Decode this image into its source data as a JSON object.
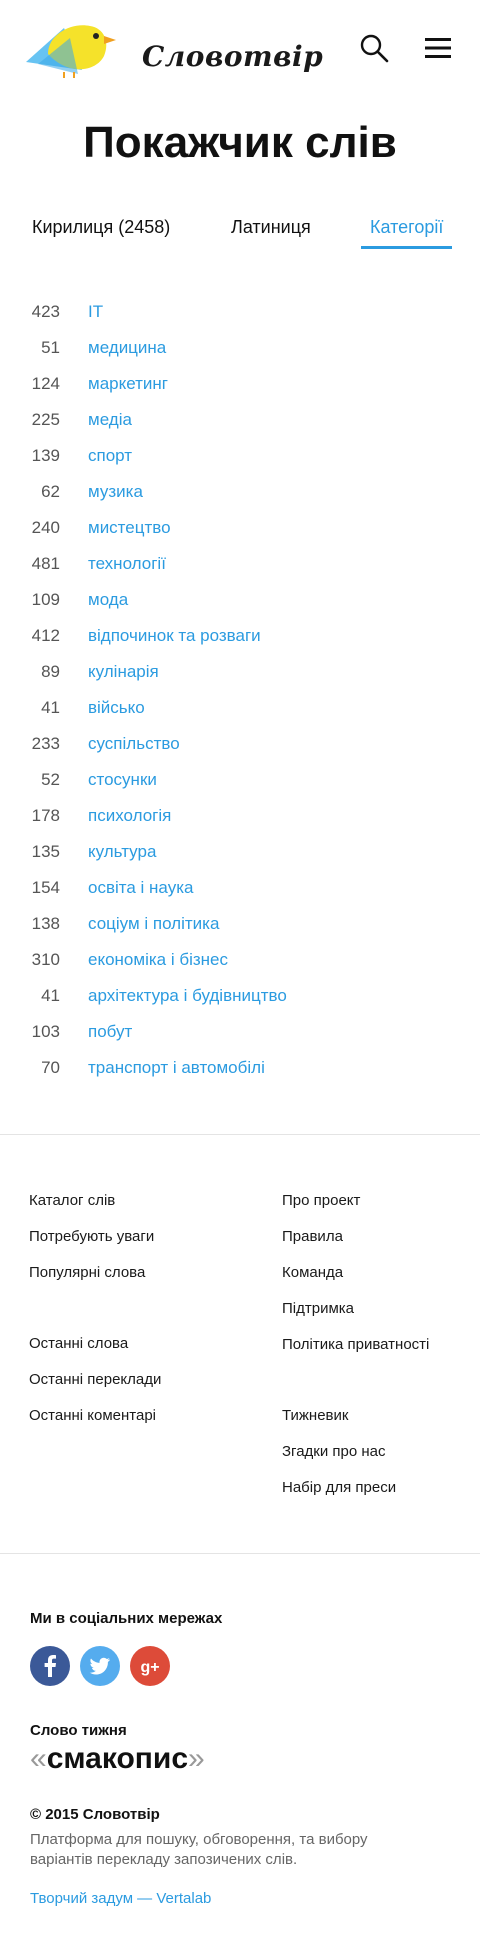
{
  "header": {
    "logo_text": "Словотвір",
    "icons": {
      "search": "search-icon",
      "menu": "hamburger-menu-icon",
      "logo": "bird-logo-icon"
    }
  },
  "page_title": "Покажчик слів",
  "tabs": [
    {
      "label": "Кирилиця (2458)",
      "active": false
    },
    {
      "label": "Латиниця",
      "active": false
    },
    {
      "label": "Категорії",
      "active": true
    }
  ],
  "categories": [
    {
      "count": "423",
      "name": "IT"
    },
    {
      "count": "51",
      "name": "медицина"
    },
    {
      "count": "124",
      "name": "маркетинг"
    },
    {
      "count": "225",
      "name": "медіа"
    },
    {
      "count": "139",
      "name": "спорт"
    },
    {
      "count": "62",
      "name": "музика"
    },
    {
      "count": "240",
      "name": "мистецтво"
    },
    {
      "count": "481",
      "name": "технології"
    },
    {
      "count": "109",
      "name": "мода"
    },
    {
      "count": "412",
      "name": "відпочинок та розваги"
    },
    {
      "count": "89",
      "name": "кулінарія"
    },
    {
      "count": "41",
      "name": "військо"
    },
    {
      "count": "233",
      "name": "суспільство"
    },
    {
      "count": "52",
      "name": "стосунки"
    },
    {
      "count": "178",
      "name": "психологія"
    },
    {
      "count": "135",
      "name": "культура"
    },
    {
      "count": "154",
      "name": "освіта і наука"
    },
    {
      "count": "138",
      "name": "соціум і політика"
    },
    {
      "count": "310",
      "name": "економіка і бізнес"
    },
    {
      "count": "41",
      "name": "архітектура і будівництво"
    },
    {
      "count": "103",
      "name": "побут"
    },
    {
      "count": "70",
      "name": "транспорт і автомобілі"
    }
  ],
  "footer": {
    "left_links": [
      "Каталог слів",
      "Потребують уваги",
      "Популярні слова",
      "Останні слова",
      "Останні переклади",
      "Останні коментарі"
    ],
    "right_links": [
      "Про проект",
      "Правила",
      "Команда",
      "Підтримка",
      "Політика приватності",
      "Тижневик",
      "Згадки про нас",
      "Набір для преси"
    ]
  },
  "social": {
    "title": "Ми в соціальних мережах",
    "networks": [
      "facebook-icon",
      "twitter-icon",
      "google-plus-icon"
    ],
    "colors": {
      "facebook": "#3b5998",
      "twitter": "#55acee",
      "google_plus": "#dd4b39"
    }
  },
  "word_of_week": {
    "title": "Слово тижня",
    "open_quote": "«",
    "word": "смакопис",
    "close_quote": "»"
  },
  "copyright": "© 2015 Словотвір",
  "description": "Платформа для пошуку, обговорення, та вибору варіантів перекладу запозичених слів.",
  "credit": "Творчий задум — Vertalab",
  "colors": {
    "accent": "#2b9be0",
    "logo_blue": "#4cb8f0",
    "logo_yellow": "#f5e22a"
  }
}
